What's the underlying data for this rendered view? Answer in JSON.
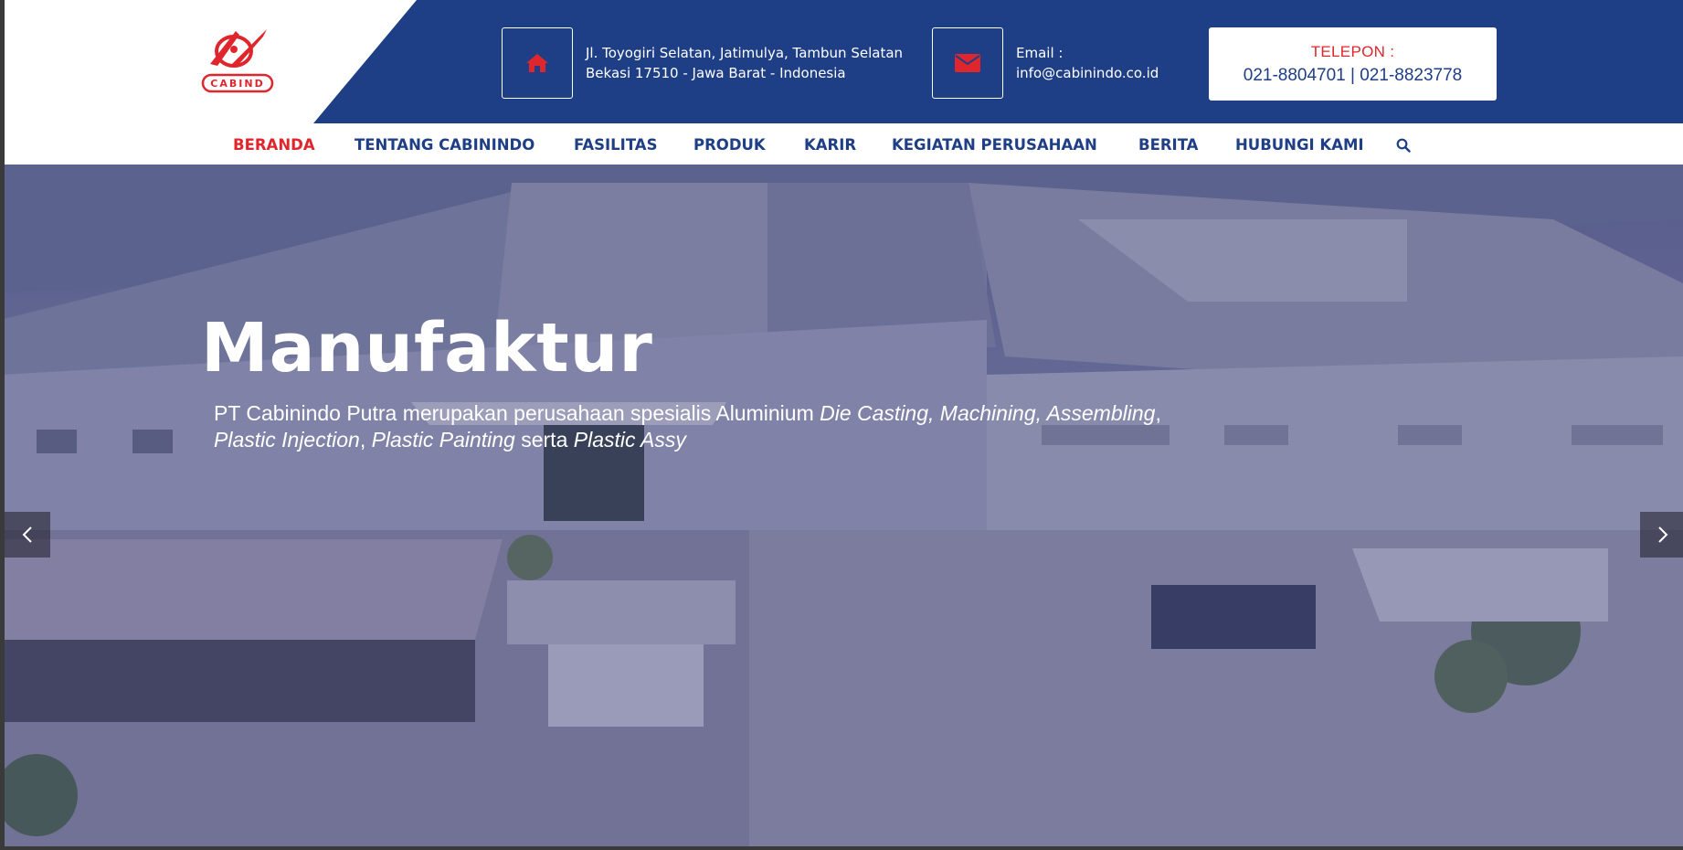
{
  "brand": {
    "logo_text": "CABIND",
    "accent": "#e0262d",
    "primary": "#1e3f85"
  },
  "header": {
    "address": {
      "icon": "home-icon",
      "line1": "Jl. Toyogiri Selatan, Jatimulya, Tambun Selatan",
      "line2": "Bekasi 17510 - Jawa Barat - Indonesia"
    },
    "email": {
      "icon": "envelope-icon",
      "label": "Email :",
      "value": "info@cabinindo.co.id"
    },
    "phone": {
      "label": "TELEPON :",
      "numbers": "021-8804701 | 021-8823778"
    }
  },
  "nav": {
    "items": [
      {
        "label": "BERANDA",
        "active": true
      },
      {
        "label": "TENTANG CABININDO"
      },
      {
        "label": "FASILITAS"
      },
      {
        "label": "PRODUK"
      },
      {
        "label": "KARIR"
      },
      {
        "label": "KEGIATAN PERUSAHAAN"
      },
      {
        "label": "BERITA"
      },
      {
        "label": "HUBUNGI KAMI"
      }
    ],
    "search_icon": "search-icon"
  },
  "hero": {
    "title": "Manufaktur",
    "desc_part1": "PT Cabinindo Putra merupakan perusahaan spesialis Aluminium ",
    "desc_italic1": "Die Casting, Machining, Assembling",
    "desc_comma1": ",",
    "desc_italic2": "Plastic Injection",
    "desc_comma2": ", ",
    "desc_italic3": "Plastic Painting",
    "desc_part2": " serta ",
    "desc_italic4": "Plastic Assy",
    "prev_icon": "chevron-left-icon",
    "next_icon": "chevron-right-icon"
  }
}
